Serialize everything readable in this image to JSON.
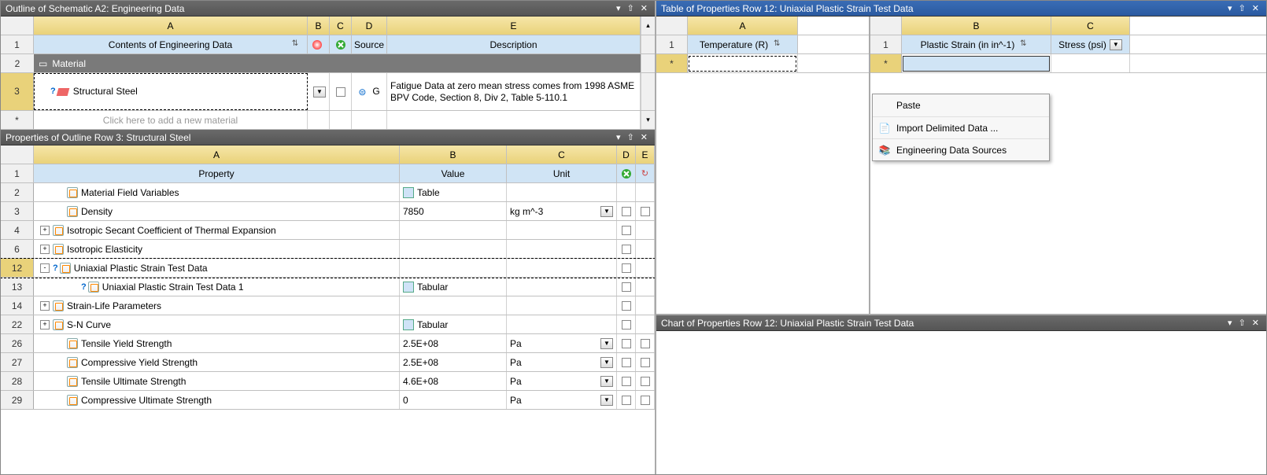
{
  "outline": {
    "title": "Outline of Schematic A2: Engineering Data",
    "cols_letters": [
      "A",
      "B",
      "C",
      "D",
      "E"
    ],
    "col_a_header": "Contents of Engineering Data",
    "col_d_header": "Source",
    "col_e_header": "Description",
    "material_group": "Material",
    "row3_content": "Structural Steel",
    "row3_desc": "Fatigue Data at zero mean stress comes from 1998 ASME BPV Code, Section 8, Div 2, Table 5-110.1",
    "add_material": "Click here to add a new material"
  },
  "props": {
    "title": "Properties of Outline Row 3: Structural Steel",
    "cols_letters": [
      "A",
      "B",
      "C",
      "D",
      "E"
    ],
    "col_a_header": "Property",
    "col_b_header": "Value",
    "col_c_header": "Unit",
    "rows": [
      {
        "n": "2",
        "a": "Material Field Variables",
        "b": "Table",
        "btype": "table",
        "c": "",
        "exp": "",
        "ind": 1
      },
      {
        "n": "3",
        "a": "Density",
        "b": "7850",
        "c": "kg m^-3",
        "cdd": true,
        "exp": "",
        "ind": 1,
        "d": true,
        "e": true
      },
      {
        "n": "4",
        "a": "Isotropic Secant Coefficient of Thermal Expansion",
        "b": "",
        "c": "",
        "exp": "+",
        "ind": 0,
        "d": true
      },
      {
        "n": "6",
        "a": "Isotropic Elasticity",
        "b": "",
        "c": "",
        "exp": "+",
        "ind": 0,
        "d": true
      },
      {
        "n": "12",
        "a": "Uniaxial Plastic Strain Test Data",
        "b": "",
        "c": "",
        "exp": "-",
        "ind": 0,
        "sel": true,
        "q": true,
        "d": true,
        "dashed": true
      },
      {
        "n": "13",
        "a": "Uniaxial Plastic Strain Test Data 1",
        "b": "Tabular",
        "btype": "table",
        "c": "",
        "exp": "",
        "ind": 2,
        "q": true,
        "d": true
      },
      {
        "n": "14",
        "a": "Strain-Life Parameters",
        "b": "",
        "c": "",
        "exp": "+",
        "ind": 0,
        "d": true
      },
      {
        "n": "22",
        "a": "S-N Curve",
        "b": "Tabular",
        "btype": "table",
        "c": "",
        "exp": "+",
        "ind": 0,
        "d": true
      },
      {
        "n": "26",
        "a": "Tensile Yield Strength",
        "b": "2.5E+08",
        "c": "Pa",
        "cdd": true,
        "ind": 1,
        "d": true,
        "e": true
      },
      {
        "n": "27",
        "a": "Compressive Yield Strength",
        "b": "2.5E+08",
        "c": "Pa",
        "cdd": true,
        "ind": 1,
        "d": true,
        "e": true
      },
      {
        "n": "28",
        "a": "Tensile Ultimate Strength",
        "b": "4.6E+08",
        "c": "Pa",
        "cdd": true,
        "ind": 1,
        "d": true,
        "e": true
      },
      {
        "n": "29",
        "a": "Compressive Ultimate Strength",
        "b": "0",
        "c": "Pa",
        "cdd": true,
        "ind": 1,
        "d": true,
        "e": true
      }
    ]
  },
  "table": {
    "title": "Table of Properties Row 12: Uniaxial Plastic Strain Test Data",
    "left_col_letter": "A",
    "left_col_header": "Temperature (R)",
    "right_col_letters": [
      "B",
      "C"
    ],
    "right_col_b": "Plastic Strain (in in^-1)",
    "right_col_c": "Stress (psi)"
  },
  "ctx": {
    "paste": "Paste",
    "import": "Import Delimited Data  ...",
    "sources": "Engineering Data Sources"
  },
  "chart": {
    "title": "Chart of Properties Row 12: Uniaxial Plastic Strain Test Data"
  },
  "rownums": {
    "one": "1",
    "two": "2",
    "three": "3",
    "star": "*"
  }
}
